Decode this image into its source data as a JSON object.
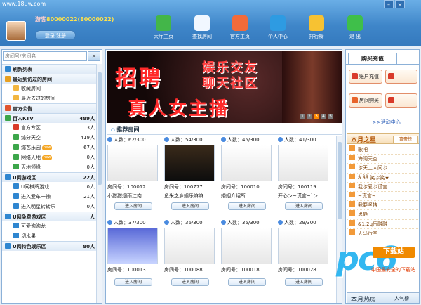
{
  "header": {
    "site": "www.18uw.com",
    "user_prefix": "游客",
    "user_id": "80000022",
    "user_id_paren": "(80000022)",
    "login_label": "登录 注册"
  },
  "toolbar": [
    {
      "label": "大厅主页",
      "icon": "refresh-icon",
      "color": "#43b649"
    },
    {
      "label": "查找房间",
      "icon": "search-icon",
      "color": "#f1f7ff"
    },
    {
      "label": "官方主页",
      "icon": "home-icon",
      "color": "#f26b3a"
    },
    {
      "label": "个人中心",
      "icon": "user-icon",
      "color": "#2e9be2"
    },
    {
      "label": "排行榜",
      "icon": "chart-icon",
      "color": "#f7c232"
    },
    {
      "label": "退 出",
      "icon": "exit-icon",
      "color": "#3fbf4a"
    }
  ],
  "window": {
    "min": "–",
    "close": "×"
  },
  "search": {
    "placeholder": "房间号/房间名"
  },
  "tree": [
    {
      "text": "刷新列表",
      "count": "",
      "level": 0,
      "head": true,
      "icon": "#2f86d0"
    },
    {
      "text": "最近到访过的房间",
      "count": "",
      "level": 0,
      "head": true,
      "icon": "#e7a021"
    },
    {
      "text": "收藏房间",
      "count": "",
      "level": 1,
      "head": false,
      "icon": "#f2b640"
    },
    {
      "text": "最近去过的房间",
      "count": "",
      "level": 1,
      "head": false,
      "icon": "#f2b640"
    },
    {
      "text": "官方公告",
      "count": "",
      "level": 0,
      "head": true,
      "icon": "#e0542e"
    },
    {
      "text": "百人KTV",
      "count": "489人",
      "level": 0,
      "head": true,
      "icon": "#3ca64a"
    },
    {
      "text": "官方专区",
      "count": "3人",
      "level": 1,
      "head": false,
      "icon": "#d93a2a"
    },
    {
      "text": "综分天空",
      "count": "419人",
      "level": 1,
      "head": false,
      "icon": "#3ca64a"
    },
    {
      "text": "综艺乐园",
      "count": "67人",
      "level": 1,
      "head": false,
      "icon": "#3ca64a",
      "new": "new"
    },
    {
      "text": "网络天地",
      "count": "0人",
      "level": 1,
      "head": false,
      "icon": "#3ca64a",
      "new": "new"
    },
    {
      "text": "天地领缘",
      "count": "0人",
      "level": 1,
      "head": false,
      "icon": "#3ca64a"
    },
    {
      "text": "U网游戏区",
      "count": "22人",
      "level": 0,
      "head": true,
      "icon": "#2f86d0"
    },
    {
      "text": "U网棋牌游戏",
      "count": "0人",
      "level": 1,
      "head": false,
      "icon": "#2f86d0"
    },
    {
      "text": "进入爱车一辣",
      "count": "21人",
      "level": 1,
      "head": false,
      "icon": "#2f86d0"
    },
    {
      "text": "进入明星转转乐",
      "count": "0人",
      "level": 1,
      "head": false,
      "icon": "#2f86d0"
    },
    {
      "text": "U网免费游戏区",
      "count": "人",
      "level": 0,
      "head": true,
      "icon": "#2f86d0"
    },
    {
      "text": "可爱泡泡龙",
      "count": "",
      "level": 1,
      "head": false,
      "icon": "#2f86d0"
    },
    {
      "text": "切水果",
      "count": "",
      "level": 1,
      "head": false,
      "icon": "#2f86d0"
    },
    {
      "text": "U网特色娱乐区",
      "count": "80人",
      "level": 0,
      "head": true,
      "icon": "#2f86d0"
    }
  ],
  "banner": {
    "big1": "招聘",
    "line1": "娱乐交友",
    "line2": "聊天社区",
    "big2": "真人女主播",
    "dots": [
      "1",
      "2",
      "3",
      "4",
      "5"
    ]
  },
  "rooms_title": "推荐房间",
  "rooms": [
    {
      "count": "人数：62/300",
      "id": "房间号：100012",
      "name": "小甜甜烟雨江南",
      "style": "light"
    },
    {
      "count": "人数：54/300",
      "id": "房间号：100777",
      "name": "鱼米之乡娱乐嘛嘛",
      "style": "dark"
    },
    {
      "count": "人数：45/300",
      "id": "房间号：100010",
      "name": "婚姻介绍所",
      "style": "light"
    },
    {
      "count": "人数：41/300",
      "id": "房间号：100119",
      "name": "开心ン~谎言~`ン",
      "style": "light"
    },
    {
      "count": "人数：37/300",
      "id": "房间号：100013",
      "name": "",
      "style": "blue"
    },
    {
      "count": "人数：36/300",
      "id": "房间号：100088",
      "name": "",
      "style": "light"
    },
    {
      "count": "人数：35/300",
      "id": "房间号：100018",
      "name": "",
      "style": "light"
    },
    {
      "count": "人数：29/300",
      "id": "房间号：100028",
      "name": "",
      "style": "light"
    }
  ],
  "enter_label": "进入房间",
  "right": {
    "tab": "购买充值",
    "buttons": [
      "账户充值",
      "房间购买"
    ],
    "activity": ">>活动中心",
    "star_title": "本月之星",
    "star_rank": "富豪榜",
    "stars": [
      "歌吧",
      "海阔天空",
      "ぷ天上人间ぷ",
      "å.åå 笑ぷ笑★",
      "我ぷ爱ぷ谎言",
      "~谎言~",
      "我要坚持",
      "思静",
      "&1,2q乐融融",
      "天马行空"
    ],
    "hot_title": "本月热房",
    "hot_rank": "人气榜"
  },
  "watermark": {
    "logo": "pc6",
    "badge": "下载站",
    "slogan": "中国最安全的下载站"
  }
}
